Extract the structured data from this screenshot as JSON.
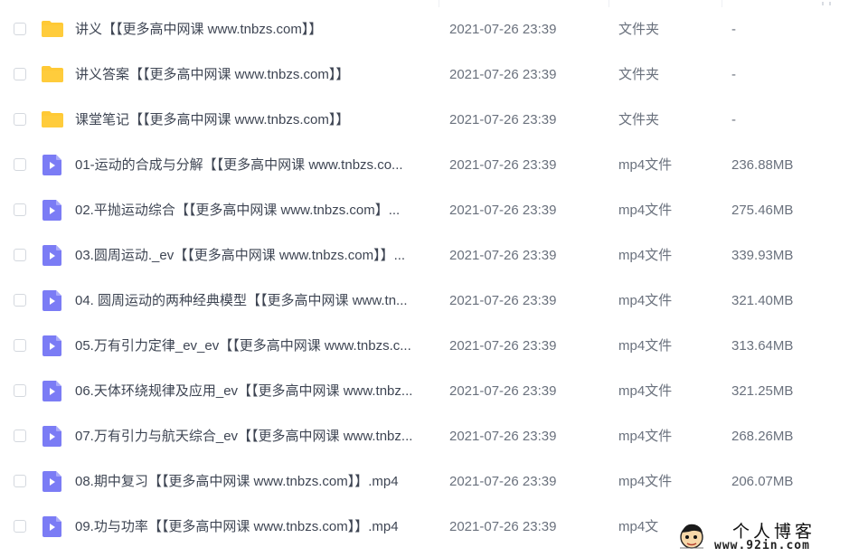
{
  "colors": {
    "folder": "#FFC935",
    "video": "#7B7CF5",
    "text": "#3E4553",
    "muted": "#6A717D"
  },
  "rows": [
    {
      "icon": "folder-icon",
      "name": "讲义【【更多高中网课 www.tnbzs.com】】",
      "date": "2021-07-26 23:39",
      "type": "文件夹",
      "size": "-"
    },
    {
      "icon": "folder-icon",
      "name": "讲义答案【【更多高中网课 www.tnbzs.com】】",
      "date": "2021-07-26 23:39",
      "type": "文件夹",
      "size": "-"
    },
    {
      "icon": "folder-icon",
      "name": "课堂笔记【【更多高中网课 www.tnbzs.com】】",
      "date": "2021-07-26 23:39",
      "type": "文件夹",
      "size": "-"
    },
    {
      "icon": "video-file-icon",
      "name": "01-运动的合成与分解【【更多高中网课 www.tnbzs.co...",
      "date": "2021-07-26 23:39",
      "type": "mp4文件",
      "size": "236.88MB"
    },
    {
      "icon": "video-file-icon",
      "name": "02.平抛运动综合【【更多高中网课 www.tnbzs.com】...",
      "date": "2021-07-26 23:39",
      "type": "mp4文件",
      "size": "275.46MB"
    },
    {
      "icon": "video-file-icon",
      "name": "03.圆周运动._ev【【更多高中网课 www.tnbzs.com】】...",
      "date": "2021-07-26 23:39",
      "type": "mp4文件",
      "size": "339.93MB"
    },
    {
      "icon": "video-file-icon",
      "name": "04. 圆周运动的两种经典模型【【更多高中网课 www.tn...",
      "date": "2021-07-26 23:39",
      "type": "mp4文件",
      "size": "321.40MB"
    },
    {
      "icon": "video-file-icon",
      "name": "05.万有引力定律_ev_ev【【更多高中网课 www.tnbzs.c...",
      "date": "2021-07-26 23:39",
      "type": "mp4文件",
      "size": "313.64MB"
    },
    {
      "icon": "video-file-icon",
      "name": "06.天体环绕规律及应用_ev【【更多高中网课 www.tnbz...",
      "date": "2021-07-26 23:39",
      "type": "mp4文件",
      "size": "321.25MB"
    },
    {
      "icon": "video-file-icon",
      "name": "07.万有引力与航天综合_ev【【更多高中网课 www.tnbz...",
      "date": "2021-07-26 23:39",
      "type": "mp4文件",
      "size": "268.26MB"
    },
    {
      "icon": "video-file-icon",
      "name": "08.期中复习【【更多高中网课 www.tnbzs.com】】.mp4",
      "date": "2021-07-26 23:39",
      "type": "mp4文件",
      "size": "206.07MB"
    },
    {
      "icon": "video-file-icon",
      "name": "09.功与功率【【更多高中网课 www.tnbzs.com】】.mp4",
      "date": "2021-07-26 23:39",
      "type": "mp4文件",
      "size": ""
    }
  ],
  "visible_type_last_row": "mp4文",
  "watermark": {
    "title": "个人博客",
    "url": "www.92in.com"
  }
}
